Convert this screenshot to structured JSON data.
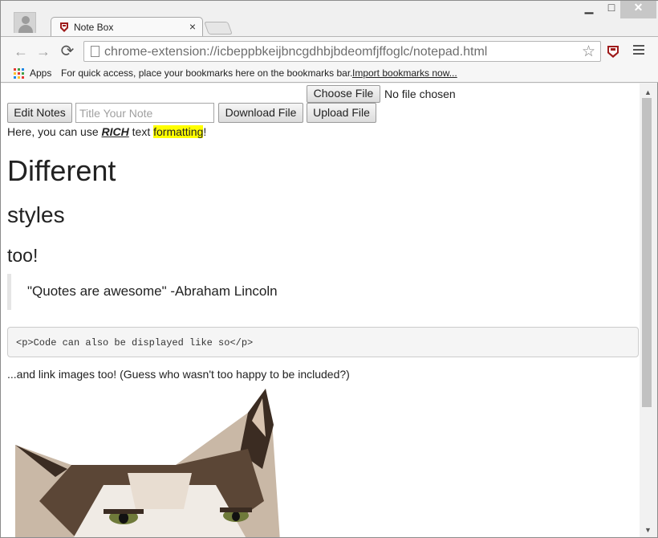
{
  "browser": {
    "tab_title": "Note Box",
    "tab_close": "×",
    "window_controls": {
      "minimize": "▁",
      "maximize": "□",
      "close": "✕"
    },
    "nav": {
      "back": "←",
      "forward": "→",
      "reload": "⟳"
    },
    "url": "chrome-extension://icbeppbkeijbncgdhbjbdeomfjffoglc/notepad.html",
    "star": "☆",
    "icons": [
      "profile-icon",
      "tab-favicon",
      "page-icon",
      "star-icon",
      "extension-icon",
      "menu-icon",
      "apps-icon"
    ]
  },
  "bookmarks": {
    "apps_label": "Apps",
    "hint": "For quick access, place your bookmarks here on the bookmarks bar.",
    "import_link": "Import bookmarks now..."
  },
  "file": {
    "choose_label": "Choose File",
    "status": "No file chosen"
  },
  "controls": {
    "edit_label": "Edit Notes",
    "title_placeholder": "Title Your Note",
    "download_label": "Download File",
    "upload_label": "Upload File"
  },
  "note": {
    "intro_before": "Here, you can use ",
    "intro_rich": "RICH",
    "intro_mid": " text ",
    "intro_formatting": "formatting",
    "intro_end": "!",
    "heading1": "Different",
    "heading2": "styles",
    "heading3": "too!",
    "quote": "\"Quotes are awesome\" -Abraham Lincoln",
    "code": "<p>Code can also be displayed like so</p>",
    "caption": "...and link images too! (Guess who wasn't too happy to be included?)"
  },
  "colors": {
    "highlight": "#ffff00",
    "text": "#222222"
  }
}
